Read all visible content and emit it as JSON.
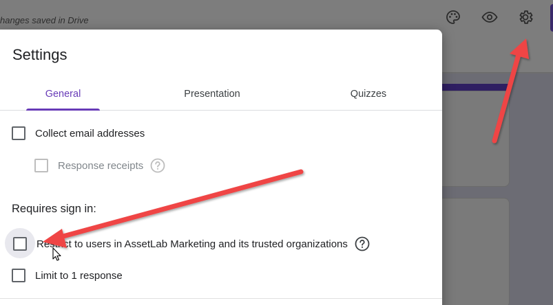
{
  "header": {
    "save_status": "hanges saved in Drive",
    "icons": [
      "palette-icon",
      "eye-icon",
      "gear-icon"
    ]
  },
  "dialog": {
    "title": "Settings",
    "tabs": [
      {
        "label": "General",
        "active": true
      },
      {
        "label": "Presentation",
        "active": false
      },
      {
        "label": "Quizzes",
        "active": false
      }
    ],
    "options": {
      "collect_email": {
        "label": "Collect email addresses",
        "checked": false
      },
      "response_receipts": {
        "label": "Response receipts",
        "checked": false,
        "disabled": true
      },
      "requires_signin_heading": "Requires sign in:",
      "restrict_users": {
        "label": "Restrict to users in AssetLab Marketing and its trusted organizations",
        "checked": false
      },
      "limit_one": {
        "label": "Limit to 1 response",
        "checked": false
      }
    }
  },
  "colors": {
    "accent": "#673ab7",
    "annotation_arrow": "#ef4444",
    "text_primary": "#202124",
    "text_disabled": "#80868b"
  }
}
